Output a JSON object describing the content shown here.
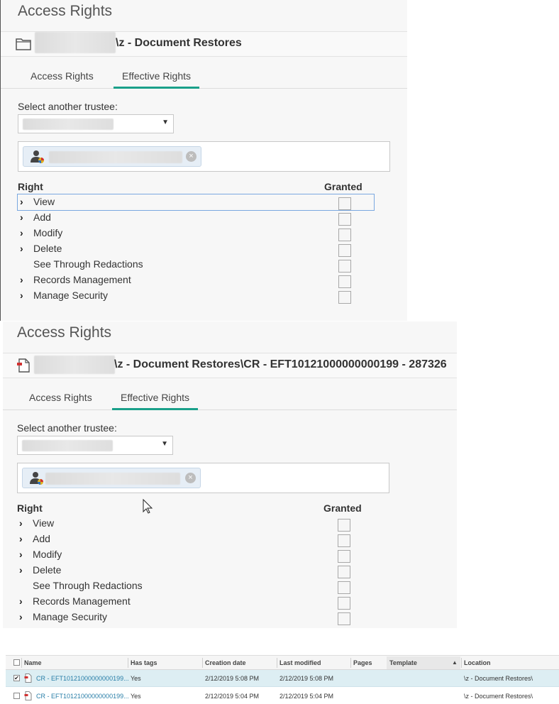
{
  "panel1": {
    "title": "Access Rights",
    "path_suffix": "\\z - Document Restores",
    "tabs": [
      "Access Rights",
      "Effective Rights"
    ],
    "trustee_label": "Select another trustee:",
    "right_header": "Right",
    "granted_header": "Granted",
    "rights": [
      "View",
      "Add",
      "Modify",
      "Delete",
      "See Through Redactions",
      "Records Management",
      "Manage Security"
    ]
  },
  "panel2": {
    "title": "Access Rights",
    "path_suffix": "\\z - Document Restores\\CR - EFT10121000000000199 - 287326",
    "tabs": [
      "Access Rights",
      "Effective Rights"
    ],
    "trustee_label": "Select another trustee:",
    "right_header": "Right",
    "granted_header": "Granted",
    "rights": [
      "View",
      "Add",
      "Modify",
      "Delete",
      "See Through Redactions",
      "Records Management",
      "Manage Security"
    ]
  },
  "grid": {
    "columns": [
      "Name",
      "Has tags",
      "Creation date",
      "Last modified",
      "Pages",
      "Template",
      "Location"
    ],
    "rows": [
      {
        "name": "CR - EFT10121000000000199...",
        "has_tags": "Yes",
        "created": "2/12/2019 5:08 PM",
        "modified": "2/12/2019 5:08 PM",
        "pages": "",
        "template": "",
        "location": "\\z - Document Restores\\"
      },
      {
        "name": "CR - EFT10121000000000199...",
        "has_tags": "Yes",
        "created": "2/12/2019 5:04 PM",
        "modified": "2/12/2019 5:04 PM",
        "pages": "",
        "template": "",
        "location": "\\z - Document Restores\\"
      }
    ]
  },
  "colors": {
    "tab_accent": "#1aa08a",
    "link": "#2a7fa8",
    "selected_row": "#ddeef3"
  }
}
